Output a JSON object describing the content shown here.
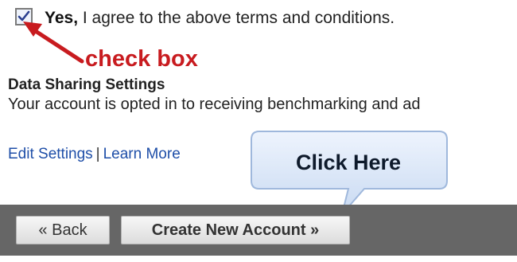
{
  "terms": {
    "checked": true,
    "label_bold": "Yes,",
    "label_rest": " I agree to the above terms and conditions."
  },
  "annotations": {
    "checkbox_label": "check box",
    "callout_label": "Click Here",
    "annotation_color": "#c81b1f"
  },
  "data_sharing": {
    "title": "Data Sharing Settings",
    "description": "Your account is opted in to receiving benchmarking and ad",
    "edit_link": "Edit Settings",
    "separator": "|",
    "learn_link": "Learn More"
  },
  "actions": {
    "back_label": "« Back",
    "create_label": "Create New Account »"
  },
  "colors": {
    "link": "#1f4fa8",
    "action_bar": "#666666",
    "callout_fill": "#dce8f8"
  }
}
